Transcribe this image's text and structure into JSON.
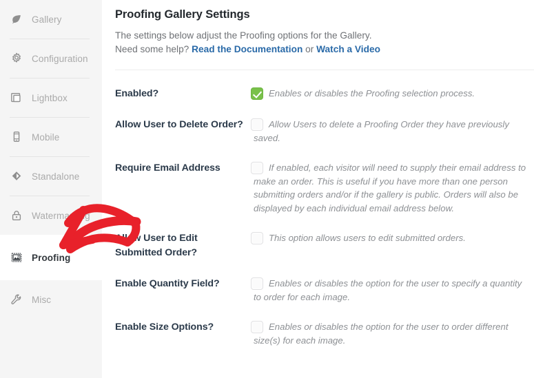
{
  "sidebar": {
    "items": [
      {
        "label": "Gallery",
        "icon": "leaf-icon",
        "active": false
      },
      {
        "label": "Configuration",
        "icon": "gear-icon",
        "active": false
      },
      {
        "label": "Lightbox",
        "icon": "lightbox-icon",
        "active": false
      },
      {
        "label": "Mobile",
        "icon": "mobile-icon",
        "active": false
      },
      {
        "label": "Standalone",
        "icon": "diamond-icon",
        "active": false
      },
      {
        "label": "Watermarking",
        "icon": "lock-icon",
        "active": false
      },
      {
        "label": "Proofing",
        "icon": "image-frame-icon",
        "active": true
      },
      {
        "label": "Misc",
        "icon": "wrench-icon",
        "active": false
      }
    ]
  },
  "main": {
    "title": "Proofing Gallery Settings",
    "intro_line1": "The settings below adjust the Proofing options for the Gallery.",
    "intro_prefix": "Need some help?",
    "link_docs": "Read the Documentation",
    "link_separator": "or",
    "link_video": "Watch a Video",
    "settings": [
      {
        "label": "Enabled?",
        "checked": true,
        "description": "Enables or disables the Proofing selection process."
      },
      {
        "label": "Allow User to Delete Order?",
        "checked": false,
        "description": "Allow Users to delete a Proofing Order they have previously saved."
      },
      {
        "label": "Require Email Address",
        "checked": false,
        "description": "If enabled, each visitor will need to supply their email address to make an order. This is useful if you have more than one person submitting orders and/or if the gallery is public. Orders will also be displayed by each individual email address below."
      },
      {
        "label": "Allow User to Edit Submitted Order?",
        "checked": false,
        "description": "This option allows users to edit submitted orders."
      },
      {
        "label": "Enable Quantity Field?",
        "checked": false,
        "description": "Enables or disables the option for the user to specify a quantity to order for each image."
      },
      {
        "label": "Enable Size Options?",
        "checked": false,
        "description": "Enables or disables the option for the user to order different size(s) for each image."
      }
    ]
  },
  "annotation": {
    "type": "red-arrow",
    "color": "#e8212a",
    "points_to": "Proofing"
  },
  "colors": {
    "sidebar_bg": "#f5f5f5",
    "active_bg": "#ffffff",
    "link": "#2a6aa8",
    "checkbox_on": "#79c14a",
    "label_text": "#2b3a4a",
    "muted_text": "#8d9094",
    "annotation_red": "#e8212a"
  }
}
